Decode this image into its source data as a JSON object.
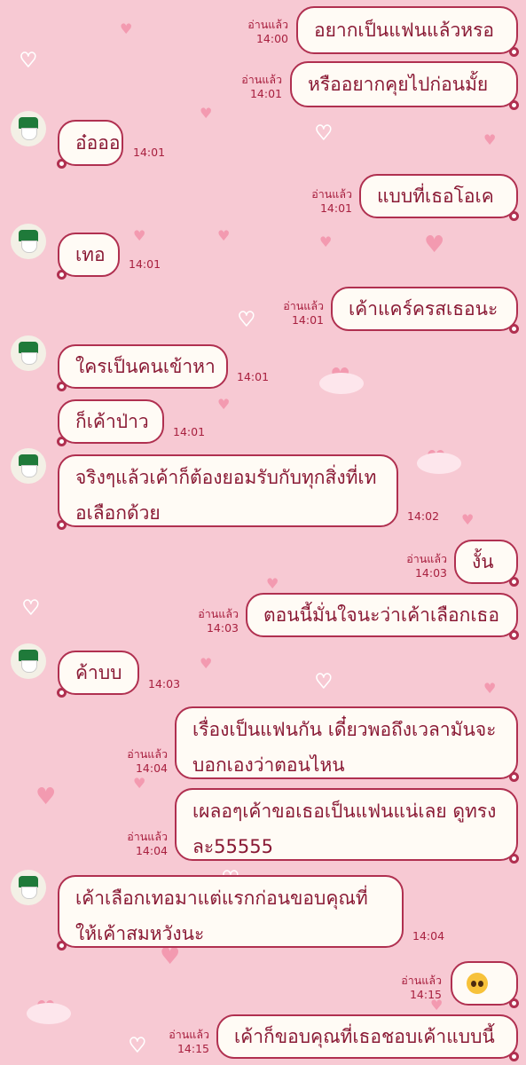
{
  "read_label": "อ่านแล้ว",
  "messages": [
    {
      "side": "out",
      "text": "อยากเป็นแฟนแล้วหรอ",
      "time": "14:00",
      "read": true
    },
    {
      "side": "out",
      "text": "หรืออยากคุยไปก่อนมั้ย",
      "time": "14:01",
      "read": true
    },
    {
      "side": "in",
      "text": "อ๋อออ",
      "time": "14:01"
    },
    {
      "side": "out",
      "text": "แบบที่เธอโอเค",
      "time": "14:01",
      "read": true
    },
    {
      "side": "in",
      "text": "เทอ",
      "time": "14:01"
    },
    {
      "side": "out",
      "text": "เค้าแคร์ครสเธอนะ",
      "time": "14:01",
      "read": true
    },
    {
      "side": "in",
      "text": "ใครเป็นคนเข้าหา",
      "time": "14:01"
    },
    {
      "side": "in",
      "text": "ก็เค้าป่าว",
      "time": "14:01"
    },
    {
      "side": "in",
      "text": "จริงๆแล้วเค้าก็ต้องยอมรับกับทุกสิ่งที่เทอเลือกด้วย",
      "time": "14:02"
    },
    {
      "side": "out",
      "text": "งั้น",
      "time": "14:03",
      "read": true
    },
    {
      "side": "out",
      "text": "ตอนนี้มั่นใจนะว่าเค้าเลือกเธอ",
      "time": "14:03",
      "read": true
    },
    {
      "side": "in",
      "text": "ค้าบบ",
      "time": "14:03"
    },
    {
      "side": "out",
      "text": "เรื่องเป็นแฟนกัน เดี๋ยวพอถึงเวลามันจะบอกเองว่าตอนไหน",
      "time": "14:04",
      "read": true
    },
    {
      "side": "out",
      "text": "เผลอๆเค้าขอเธอเป็นแฟนแน่เลย ดูทรงละ55555",
      "time": "14:04",
      "read": true
    },
    {
      "side": "in",
      "text": "เค้าเลือกเทอมาแต่แรกก่อนขอบคุณที่ให้เค้าสมหวังนะ",
      "time": "14:04"
    },
    {
      "side": "out",
      "text": "",
      "emoji": "pleading-face-emoji",
      "time": "14:15",
      "read": true
    },
    {
      "side": "out",
      "text": "เค้าก็ขอบคุณที่เธอชอบเค้าแบบนี้",
      "time": "14:15",
      "read": true
    }
  ],
  "colors": {
    "background": "#f7c9d3",
    "bubble": "#fffbf5",
    "border": "#b03050",
    "text": "#8a1a35"
  }
}
